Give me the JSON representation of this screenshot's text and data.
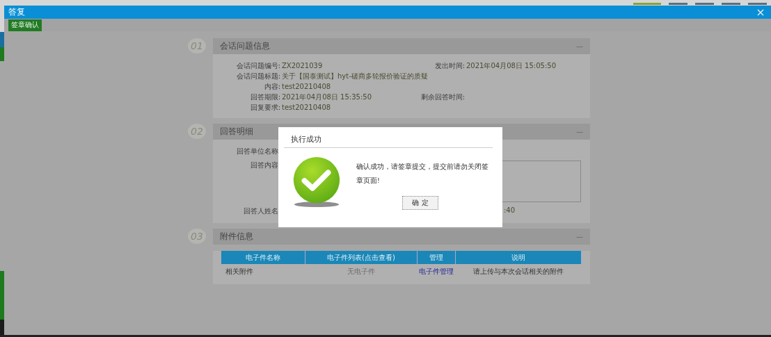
{
  "window": {
    "title": "答复"
  },
  "window_tabs": [
    {
      "selected": true
    },
    {
      "selected": false
    },
    {
      "selected": false
    },
    {
      "selected": false
    },
    {
      "selected": false
    }
  ],
  "toolbar": {
    "button": "签章确认"
  },
  "sections": [
    {
      "number": "01",
      "title": "会话问题信息",
      "toggle": "—",
      "kind": "info",
      "fields": [
        {
          "label": "会话问题编号:",
          "value": "ZX2021039",
          "side_label": "发出时间:",
          "side_value": "2021年04月08日 15:05:50"
        },
        {
          "label": "会话问题标题:",
          "value": "关于【国泰测试】hyt-磋商多轮报价验证的质疑"
        },
        {
          "label": "内容:",
          "value": "test20210408"
        },
        {
          "label": "回答期限:",
          "value": "2021年04月08日 15:35:50",
          "side_label": "剩余回答时间:"
        },
        {
          "label": "回复要求:",
          "value": "test20210408"
        }
      ]
    },
    {
      "number": "02",
      "title": "回答明细",
      "toggle": "—",
      "kind": "answer",
      "fields": [
        {
          "label": "回答单位名称",
          "kind": "text"
        },
        {
          "label": "回答内容",
          "kind": "box"
        },
        {
          "label": "回答人姓名",
          "kind": "text",
          "side_value": ":40"
        }
      ]
    },
    {
      "number": "03",
      "title": "附件信息",
      "toggle": "—",
      "kind": "table",
      "columns": [
        "电子件名称",
        "电子件列表(点击查看)",
        "管理",
        "说明"
      ],
      "rows": [
        [
          {
            "text": "相关附件",
            "kind": "text"
          },
          {
            "text": "无电子件",
            "kind": "muted"
          },
          {
            "text": "电子件管理",
            "kind": "link"
          },
          {
            "text": "请上传与本次会话相关的附件",
            "kind": "text"
          }
        ]
      ]
    }
  ],
  "dialog": {
    "title": "执行成功",
    "message": "确认成功，请签章提交，提交前请勿关闭签章页面!",
    "button": "确 定"
  }
}
